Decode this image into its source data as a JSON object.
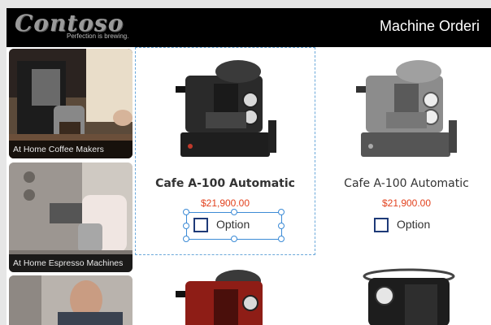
{
  "brand": {
    "logo_text": "Contoso",
    "tagline": "Perfection is brewing."
  },
  "header": {
    "title": "Machine Orderi"
  },
  "categories": [
    {
      "label": "At Home Coffee Makers"
    },
    {
      "label": "At Home Espresso Machines"
    },
    {
      "label": ""
    }
  ],
  "products": [
    {
      "name": "Cafe A-100 Automatic",
      "price": "$21,900.00",
      "option_label": "Option",
      "color": "#2a2a2a",
      "selected": true
    },
    {
      "name": "Cafe A-100 Automatic",
      "price": "$21,900.00",
      "option_label": "Option",
      "color": "#8c8c8c",
      "selected": false
    },
    {
      "name": "",
      "price": "",
      "option_label": "",
      "color": "#8e1d16",
      "selected": false
    },
    {
      "name": "",
      "price": "",
      "option_label": "",
      "color": "#1d1d1d",
      "selected": false
    }
  ],
  "colors": {
    "price": "#e2421e",
    "checkbox_border": "#1e3a78",
    "selection": "#3c8bd6"
  }
}
